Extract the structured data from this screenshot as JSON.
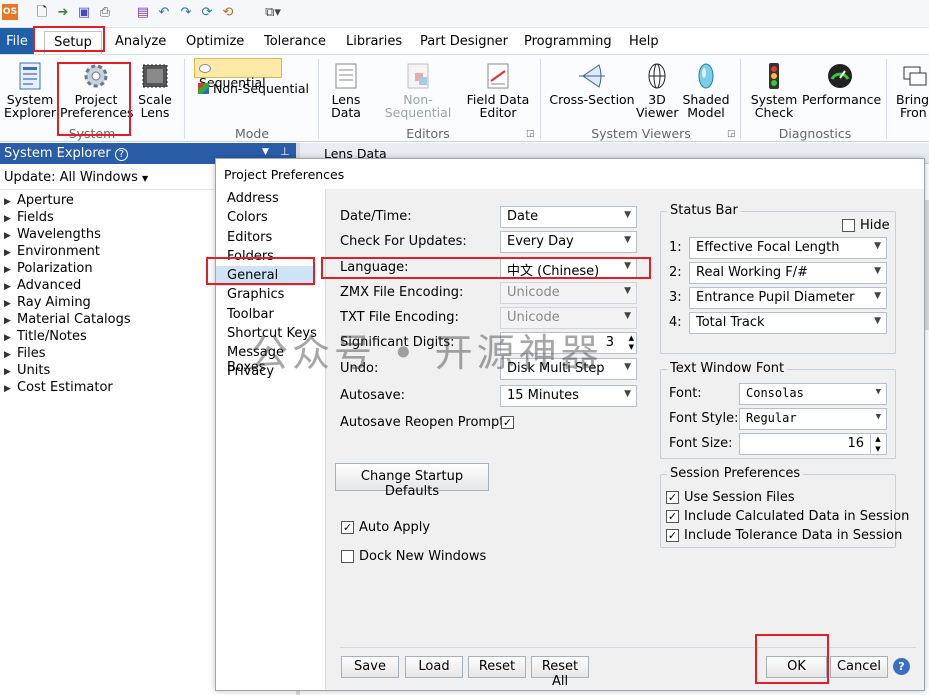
{
  "qat": {
    "logo": "OS"
  },
  "tabs": {
    "file": "File",
    "setup": "Setup",
    "analyze": "Analyze",
    "optimize": "Optimize",
    "tolerance": "Tolerance",
    "libraries": "Libraries",
    "part_designer": "Part Designer",
    "programming": "Programming",
    "help": "Help"
  },
  "ribbon": {
    "system_explorer": [
      "System",
      "Explorer"
    ],
    "project_preferences": [
      "Project",
      "Preferences"
    ],
    "scale_lens": [
      "Scale",
      "Lens"
    ],
    "group_system": "System",
    "sequential": "Sequential",
    "non_sequential": "Non-Sequential",
    "group_mode": "Mode",
    "lens_data": [
      "Lens",
      "Data"
    ],
    "non_sequential_editor": "Non-Sequential",
    "field_data": [
      "Field Data",
      "Editor"
    ],
    "group_editors": "Editors",
    "cross_section": "Cross-Section",
    "viewer_3d": [
      "3D",
      "Viewer"
    ],
    "shaded_model": [
      "Shaded",
      "Model"
    ],
    "group_system_viewers": "System Viewers",
    "system_check": [
      "System",
      "Check"
    ],
    "performance": "Performance",
    "group_diagnostics": "Diagnostics",
    "bring_front": [
      "Bring",
      "Fron"
    ]
  },
  "system_explorer": {
    "title": "System Explorer",
    "help": "?",
    "update": "Update: All Windows",
    "items": [
      "Aperture",
      "Fields",
      "Wavelengths",
      "Environment",
      "Polarization",
      "Advanced",
      "Ray Aiming",
      "Material Catalogs",
      "Title/Notes",
      "Files",
      "Units",
      "Cost Estimator"
    ]
  },
  "lens_data_tab": "Lens Data",
  "dialog": {
    "title": "Project Preferences",
    "nav": [
      "Address",
      "Colors",
      "Editors",
      "Folders",
      "General",
      "Graphics",
      "Toolbar",
      "Shortcut Keys",
      "Message Boxes",
      "Privacy"
    ],
    "general": {
      "date_time_label": "Date/Time:",
      "date_time_value": "Date",
      "check_updates_label": "Check For Updates:",
      "check_updates_value": "Every Day",
      "language_label": "Language:",
      "language_value": "中文 (Chinese)",
      "zmx_encoding_label": "ZMX File Encoding:",
      "zmx_encoding_value": "Unicode",
      "txt_encoding_label": "TXT File Encoding:",
      "txt_encoding_value": "Unicode",
      "sig_digits_label": "Significant Digits:",
      "sig_digits_value": "3",
      "undo_label": "Undo:",
      "undo_value": "Disk Multi Step",
      "autosave_label": "Autosave:",
      "autosave_value": "15 Minutes",
      "autosave_reopen_label": "Autosave Reopen Prompt:",
      "change_startup": "Change Startup Defaults",
      "auto_apply": "Auto Apply",
      "dock_new_windows": "Dock New Windows"
    },
    "status_bar": {
      "title": "Status Bar",
      "hide": "Hide",
      "rows": [
        {
          "num": "1:",
          "value": "Effective Focal Length"
        },
        {
          "num": "2:",
          "value": "Real Working F/#"
        },
        {
          "num": "3:",
          "value": "Entrance Pupil Diameter"
        },
        {
          "num": "4:",
          "value": "Total Track"
        }
      ]
    },
    "text_font": {
      "title": "Text Window Font",
      "font_label": "Font:",
      "font_value": "Consolas",
      "style_label": "Font Style:",
      "style_value": "Regular",
      "size_label": "Font Size:",
      "size_value": "16"
    },
    "session": {
      "title": "Session Preferences",
      "use_session": "Use Session Files",
      "include_calc": "Include Calculated Data in Session",
      "include_tol": "Include Tolerance Data in Session"
    },
    "footer": {
      "save": "Save",
      "load": "Load",
      "reset": "Reset",
      "reset_all": "Reset All",
      "ok": "OK",
      "cancel": "Cancel",
      "help": "?"
    }
  },
  "watermark": "公众号 • 开源神器",
  "colors": {
    "highlight": "#e21f26",
    "file_tab": "#1f5fa8",
    "explorer_title": "#2a5ca8"
  }
}
